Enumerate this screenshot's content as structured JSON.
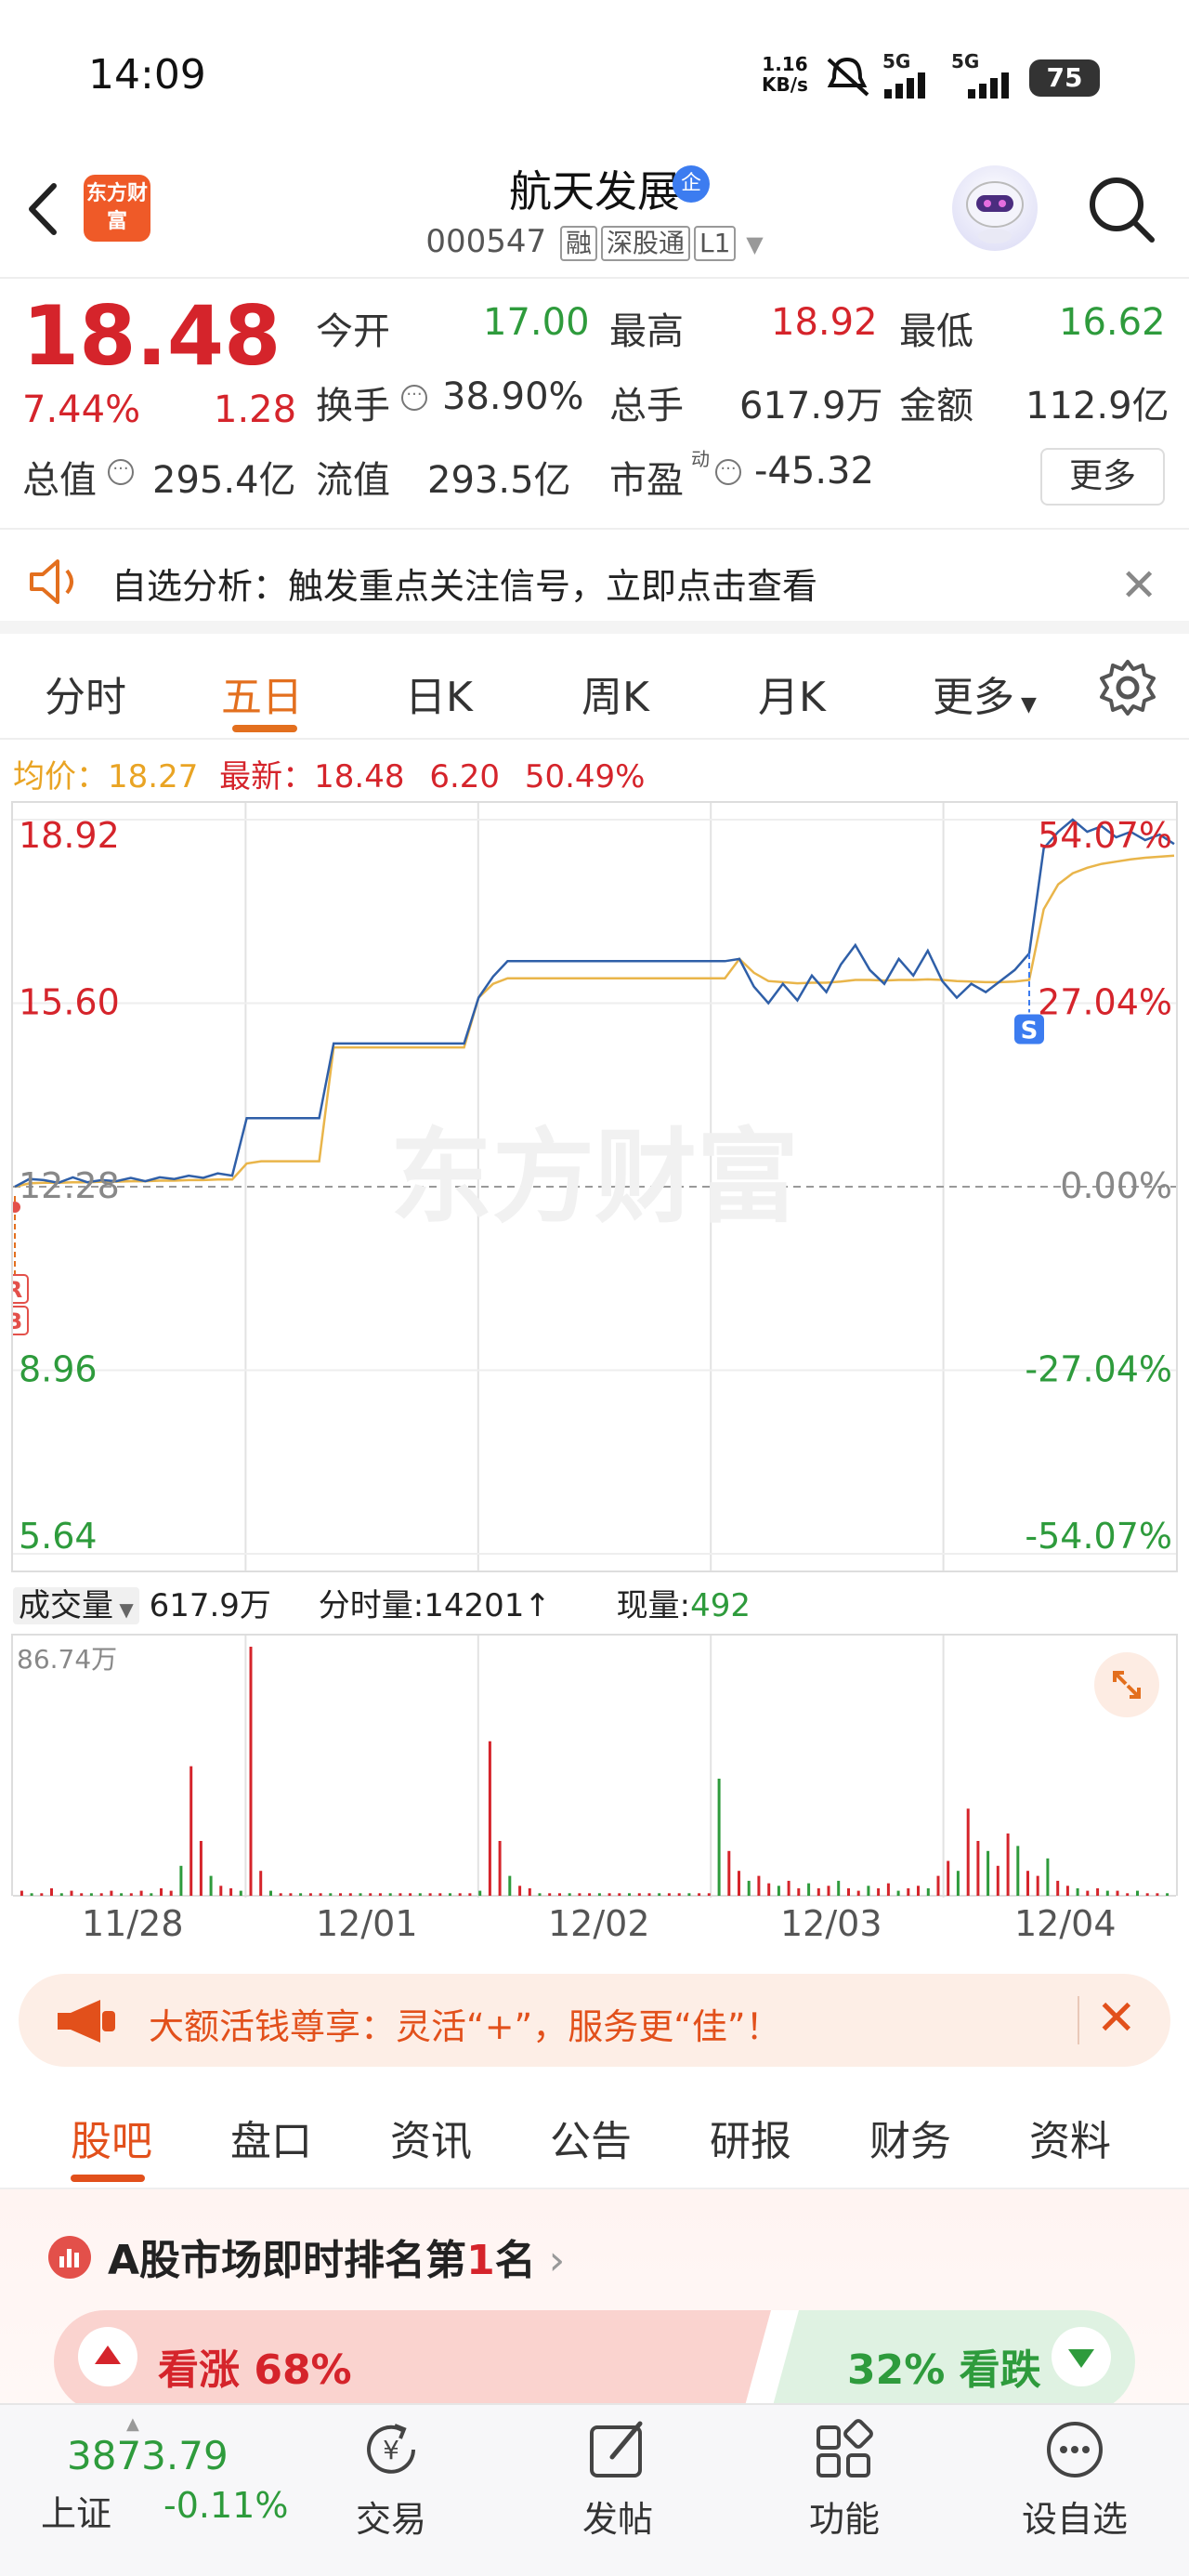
{
  "status": {
    "time": "14:09",
    "net_speed_value": "1.16",
    "net_speed_unit": "KB/s",
    "signal1": "5G",
    "signal2": "5G",
    "battery": "75"
  },
  "header": {
    "logo": "东方财富",
    "name": "航天发展",
    "badge": "企",
    "code": "000547",
    "tags": [
      "融",
      "深股通",
      "L1"
    ]
  },
  "quote": {
    "price": "18.48",
    "change_pct": "7.44%",
    "change": "1.28",
    "rows": [
      [
        {
          "label": "今开",
          "value": "17.00",
          "color": "green"
        },
        {
          "label": "最高",
          "value": "18.92",
          "color": "red"
        },
        {
          "label": "最低",
          "value": "16.62",
          "color": "green"
        }
      ],
      [
        {
          "label": "换手",
          "value": "38.90%",
          "color": "gray"
        },
        {
          "label": "总手",
          "value": "617.9万",
          "color": "gray"
        },
        {
          "label": "金额",
          "value": "112.9亿",
          "color": "gray"
        }
      ],
      [
        {
          "label": "总值",
          "value": "295.4亿",
          "color": "gray"
        },
        {
          "label": "流值",
          "value": "293.5亿",
          "color": "gray"
        },
        {
          "label": "市盈",
          "sup": "动",
          "value": "-45.32",
          "color": "gray"
        }
      ]
    ],
    "more": "更多"
  },
  "notice": {
    "text": "自选分析：触发重点关注信号，立即点击查看"
  },
  "chart_tabs": {
    "items": [
      "分时",
      "五日",
      "日K",
      "周K",
      "月K",
      "更多"
    ],
    "active": "五日"
  },
  "avg_line": {
    "avg_label": "均价：",
    "avg_value": "18.27",
    "latest_label": "最新：",
    "latest_value": "18.48",
    "change": "6.20",
    "pct": "50.49%"
  },
  "chart_data": {
    "type": "line",
    "title": "",
    "x": [
      "11/28",
      "12/01",
      "12/02",
      "12/03",
      "12/04"
    ],
    "ylim": [
      5.64,
      18.92
    ],
    "y_ticks_left": [
      "18.92",
      "15.60",
      "12.28",
      "8.96",
      "5.64"
    ],
    "y_ticks_right": [
      "54.07%",
      "27.04%",
      "0.00%",
      "-27.04%",
      "-54.07%"
    ],
    "prev_close": 12.28,
    "series": [
      {
        "color": "#2f5fa8",
        "values": [
          12.28,
          12.42,
          12.4,
          12.35,
          12.45,
          12.36,
          12.4,
          12.38,
          12.44,
          12.38,
          12.45,
          12.42,
          12.48,
          12.44,
          12.52,
          12.48,
          13.52,
          13.52,
          13.52,
          13.52,
          13.52,
          13.52,
          14.87,
          14.87,
          14.87,
          14.87,
          14.87,
          14.87,
          14.87,
          14.87,
          14.87,
          14.87,
          15.7,
          16.08,
          16.36,
          16.36,
          16.36,
          16.36,
          16.36,
          16.36,
          16.36,
          16.36,
          16.36,
          16.36,
          16.36,
          16.36,
          16.36,
          16.36,
          16.36,
          16.36,
          16.4,
          15.9,
          15.6,
          15.95,
          15.65,
          16.1,
          15.8,
          16.3,
          16.65,
          16.2,
          15.95,
          16.4,
          16.1,
          16.55,
          16.0,
          15.7,
          15.95,
          15.8,
          16.0,
          16.2,
          16.5,
          18.4,
          18.7,
          18.92,
          18.7,
          18.8,
          18.6,
          18.7,
          18.55,
          18.65,
          18.48
        ]
      },
      {
        "color": "#e9b54a",
        "values": [
          12.28,
          12.34,
          12.35,
          12.35,
          12.36,
          12.36,
          12.37,
          12.37,
          12.38,
          12.38,
          12.39,
          12.39,
          12.4,
          12.4,
          12.41,
          12.41,
          12.7,
          12.74,
          12.74,
          12.74,
          12.74,
          12.74,
          14.8,
          14.8,
          14.8,
          14.8,
          14.8,
          14.8,
          14.8,
          14.8,
          14.8,
          14.8,
          15.7,
          15.95,
          16.05,
          16.05,
          16.05,
          16.05,
          16.05,
          16.05,
          16.05,
          16.05,
          16.05,
          16.05,
          16.05,
          16.05,
          16.05,
          16.05,
          16.05,
          16.05,
          16.4,
          16.15,
          16.0,
          15.98,
          15.96,
          15.97,
          15.97,
          15.99,
          16.02,
          16.02,
          16.01,
          16.02,
          16.02,
          16.03,
          16.02,
          16.0,
          15.99,
          15.98,
          15.98,
          15.99,
          16.02,
          17.3,
          17.75,
          17.95,
          18.05,
          18.12,
          18.16,
          18.2,
          18.23,
          18.25,
          18.27
        ]
      }
    ],
    "markers": [
      {
        "label": "S",
        "x_index": 70
      },
      {
        "label": "R",
        "x_index": 0
      },
      {
        "label": "B",
        "x_index": 0
      }
    ],
    "volume": {
      "header_label": "成交量",
      "total": "617.9万",
      "fenshi_label": "分时量:",
      "fenshi_value": "14201",
      "xianliang_label": "现量:",
      "xianliang_value": "492",
      "max_label": "86.74万",
      "values": [
        2,
        1,
        1,
        3,
        1,
        2,
        1,
        1,
        1,
        2,
        1,
        1,
        2,
        1,
        3,
        2,
        12,
        52,
        22,
        8,
        4,
        3,
        2,
        100,
        10,
        2,
        1,
        1,
        1,
        1,
        1,
        1,
        1,
        1,
        1,
        1,
        1,
        1,
        1,
        1,
        1,
        1,
        1,
        1,
        1,
        1,
        2,
        62,
        22,
        8,
        4,
        3,
        1,
        1,
        1,
        1,
        1,
        1,
        1,
        1,
        1,
        1,
        1,
        1,
        1,
        1,
        1,
        1,
        1,
        1,
        47,
        18,
        10,
        6,
        8,
        5,
        4,
        6,
        3,
        5,
        3,
        4,
        6,
        3,
        2,
        4,
        3,
        5,
        2,
        3,
        4,
        3,
        8,
        14,
        10,
        35,
        22,
        18,
        12,
        25,
        20,
        10,
        8,
        15,
        6,
        4,
        3,
        2,
        3,
        2,
        2,
        1,
        2,
        1,
        1,
        1
      ]
    }
  },
  "promo": {
    "text": "大额活钱尊享：灵活“+”，服务更“佳”！"
  },
  "info_tabs": {
    "items": [
      "股吧",
      "盘口",
      "资讯",
      "公告",
      "研报",
      "财务",
      "资料"
    ],
    "active": "股吧"
  },
  "rank": {
    "prefix": "A股市场即时排名第",
    "number": "1",
    "suffix": "名",
    "bull_label": "看涨",
    "bull_pct": "68%",
    "bear_pct": "32%",
    "bear_label": "看跌"
  },
  "bottom_nav": {
    "index_value": "3873.79",
    "index_name": "上证",
    "index_change": "-0.11%",
    "items": [
      "交易",
      "发帖",
      "功能",
      "设自选"
    ]
  }
}
